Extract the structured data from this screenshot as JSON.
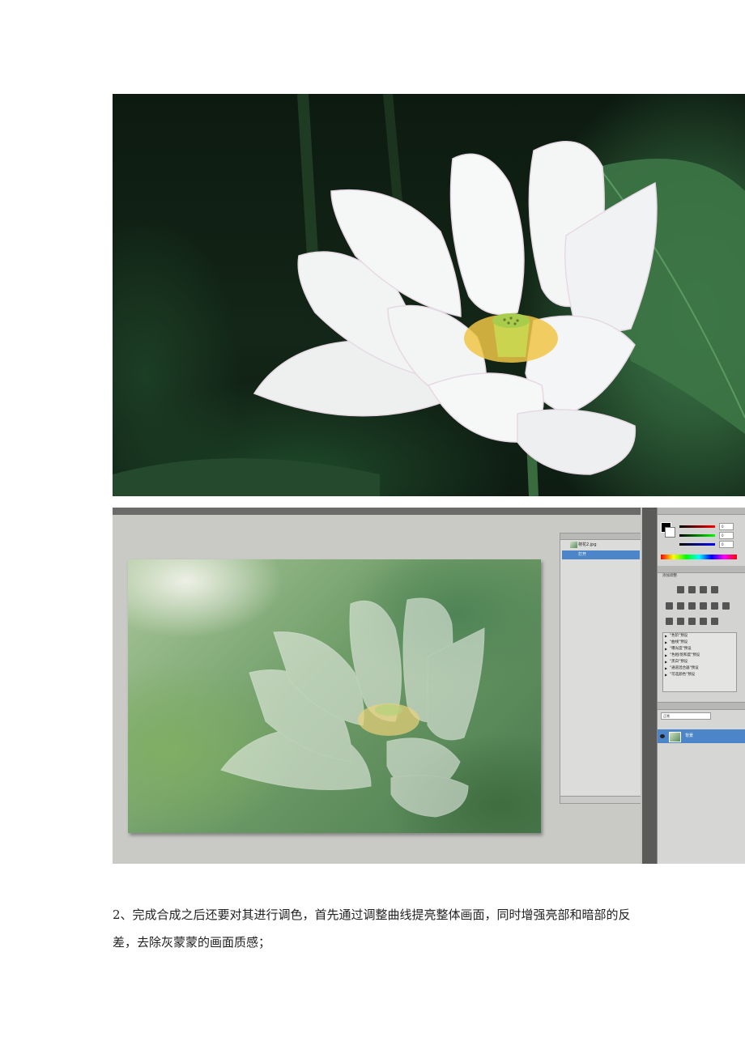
{
  "images": {
    "lotus_photo": {
      "alt": "lotus-photo"
    },
    "photoshop_screenshot": {
      "history_panel": {
        "rows": [
          "荷花2.jpg",
          "打开"
        ]
      },
      "color_panel": {
        "slider_values": [
          "0",
          "0",
          "0"
        ]
      },
      "adjustments_panel": {
        "title": "添加调整",
        "presets": [
          "\"色阶\"预设",
          "\"曲线\"预设",
          "\"曝光度\"预设",
          "\"色相/饱和度\"预设",
          "\"黑白\"预设",
          "\"通道混合器\"预设",
          "\"可选颜色\"预设"
        ]
      },
      "layers_panel": {
        "blend_mode": "正常",
        "layer_name": "背景"
      }
    }
  },
  "text": {
    "paragraph": "2、完成合成之后还要对其进行调色，首先通过调整曲线提亮整体画面，同时增强亮部和暗部的反差，去除灰蒙蒙的画面质感；"
  },
  "colors": {
    "selection_blue": "#4d86c8",
    "workspace_gray": "#c9cac6"
  }
}
